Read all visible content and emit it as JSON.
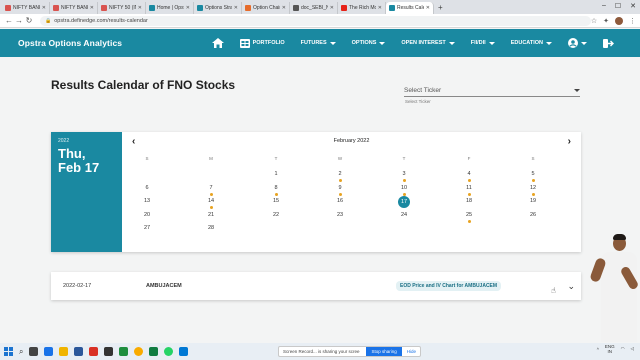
{
  "browser": {
    "tabs": [
      {
        "label": "NIFTY BANK",
        "color": "#d9534f",
        "active": false
      },
      {
        "label": "NIFTY BANK",
        "color": "#d9534f",
        "active": false
      },
      {
        "label": "NIFTY 50 (IN",
        "color": "#d9534f",
        "active": false
      },
      {
        "label": "Home | Opstr",
        "color": "#1a89a1",
        "active": false
      },
      {
        "label": "Options Strate",
        "color": "#1a89a1",
        "active": false
      },
      {
        "label": "Option Chain",
        "color": "#e66c2c",
        "active": false
      },
      {
        "label": "doc_SEBI_No",
        "color": "#555555",
        "active": false
      },
      {
        "label": "The Rich Mon",
        "color": "#e62117",
        "active": false
      },
      {
        "label": "Results Calend",
        "color": "#1a89a1",
        "active": true
      }
    ],
    "url": "opstra.definedge.com/results-calendar"
  },
  "header": {
    "brand": "Opstra Options Analytics",
    "nav": [
      {
        "label": "PORTFOLIO",
        "dropdown": false
      },
      {
        "label": "FUTURES",
        "dropdown": true
      },
      {
        "label": "OPTIONS",
        "dropdown": true
      },
      {
        "label": "OPEN INTEREST",
        "dropdown": true
      },
      {
        "label": "FII/DII",
        "dropdown": true
      },
      {
        "label": "EDUCATION",
        "dropdown": true
      }
    ]
  },
  "page": {
    "title": "Results Calendar of FNO Stocks",
    "ticker_placeholder": "Select Ticker",
    "ticker_helper": "Select Ticker"
  },
  "calendar": {
    "year": "2022",
    "weekday": "Thu,",
    "date_short": "Feb 17",
    "month_label": "February 2022",
    "weekdays": [
      "S",
      "M",
      "T",
      "W",
      "T",
      "F",
      "S"
    ],
    "weeks": [
      [
        null,
        null,
        {
          "d": "1",
          "dot": false
        },
        {
          "d": "2",
          "dot": true
        },
        {
          "d": "3",
          "dot": true
        },
        {
          "d": "4",
          "dot": true
        },
        {
          "d": "5",
          "dot": true
        }
      ],
      [
        {
          "d": "6",
          "dot": false
        },
        {
          "d": "7",
          "dot": true
        },
        {
          "d": "8",
          "dot": true
        },
        {
          "d": "9",
          "dot": true
        },
        {
          "d": "10",
          "dot": true
        },
        {
          "d": "11",
          "dot": true
        },
        {
          "d": "12",
          "dot": true
        }
      ],
      [
        {
          "d": "13",
          "dot": false
        },
        {
          "d": "14",
          "dot": true
        },
        {
          "d": "15",
          "dot": false
        },
        {
          "d": "16",
          "dot": false
        },
        {
          "d": "17",
          "dot": false,
          "selected": true
        },
        {
          "d": "18",
          "dot": false
        },
        {
          "d": "19",
          "dot": false
        }
      ],
      [
        {
          "d": "20",
          "dot": false
        },
        {
          "d": "21",
          "dot": false
        },
        {
          "d": "22",
          "dot": false
        },
        {
          "d": "23",
          "dot": false
        },
        {
          "d": "24",
          "dot": false
        },
        {
          "d": "25",
          "dot": true
        },
        {
          "d": "26",
          "dot": false
        }
      ],
      [
        {
          "d": "27",
          "dot": false
        },
        {
          "d": "28",
          "dot": false
        }
      ]
    ],
    "accent": "#1a89a1",
    "dot_color": "#e8a321"
  },
  "result": {
    "date": "2022-02-17",
    "symbol": "AMBUJACEM",
    "link": "EOD Price and IV Chart for AMBUJACEM"
  },
  "taskbar": {
    "share_text": "Screen Record... is sharing your scree",
    "share_button": "Stop sharing",
    "share_hide": "Hide",
    "lang_top": "ENG",
    "lang_bottom": "IN"
  }
}
